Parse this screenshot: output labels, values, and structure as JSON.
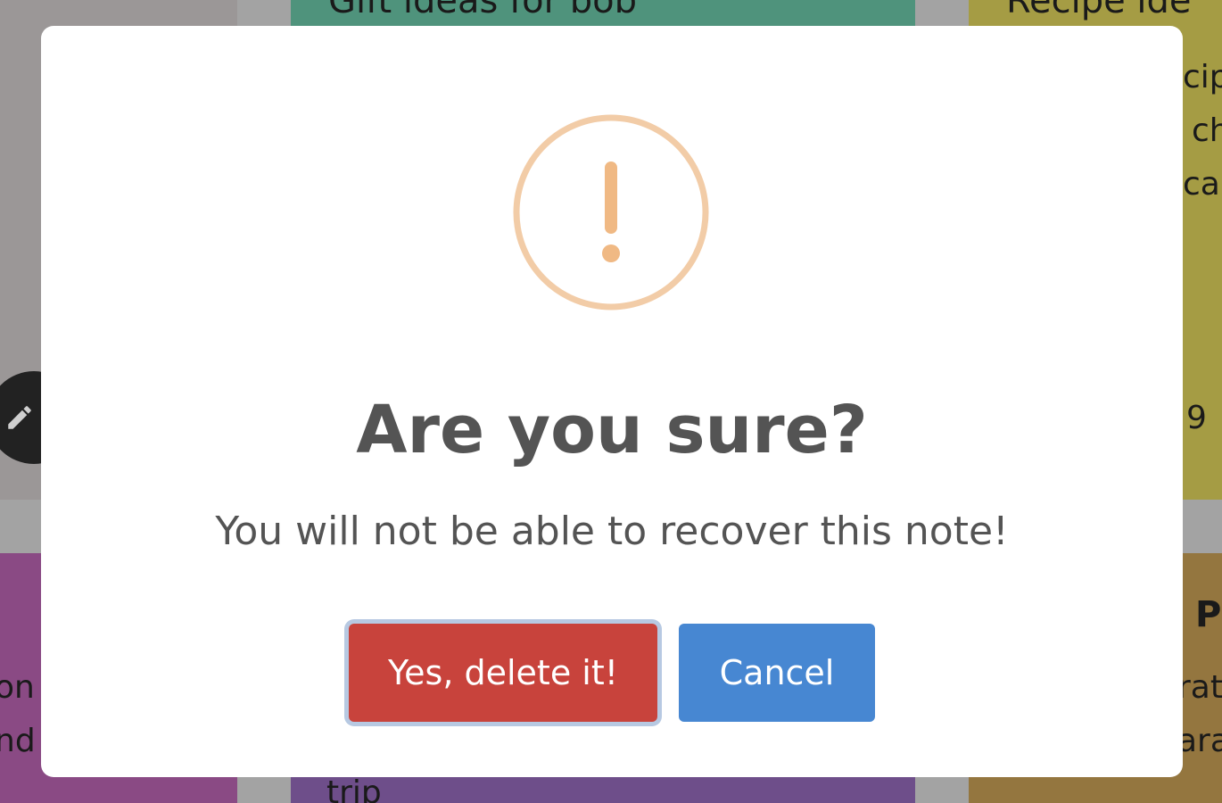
{
  "background_notes": {
    "green_title": "Gift ideas for bob",
    "yellow_title": "Recipe ide",
    "yellow_lines": [
      "cip",
      "ch",
      "ca",
      "9"
    ],
    "purple_lines": [
      "on",
      "nd"
    ],
    "violet_lines": [
      "trip"
    ],
    "ochre_title": "P",
    "ochre_lines": [
      "rati",
      "ara"
    ]
  },
  "fab": {
    "icon": "pencil-icon"
  },
  "dialog": {
    "icon": "warning-exclamation-icon",
    "icon_color": "#f2cca7",
    "title": "Are you sure?",
    "text": "You will not be able to recover this note!",
    "confirm_label": "Yes, delete it!",
    "cancel_label": "Cancel",
    "confirm_color": "#c8433c",
    "cancel_color": "#4787d2"
  }
}
